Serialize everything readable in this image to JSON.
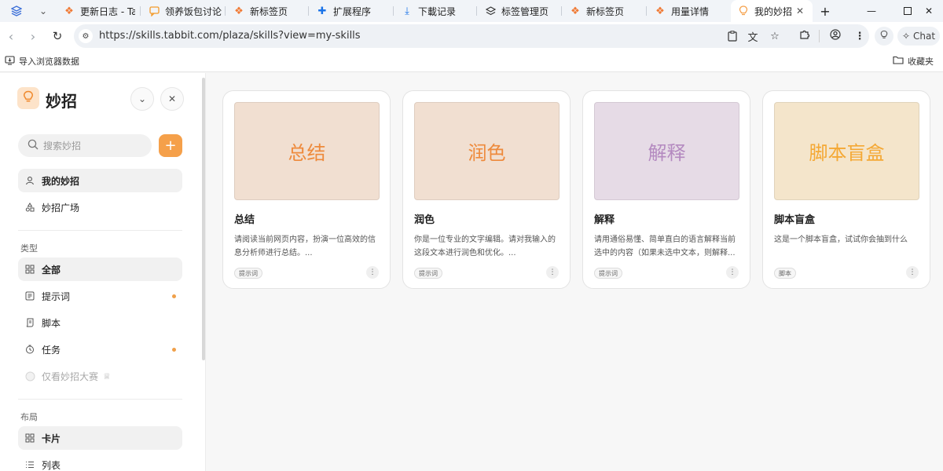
{
  "tabs": [
    {
      "title": "更新日志 - Tabl",
      "icon": "tabbit-logo-icon",
      "color": "#f07a35"
    },
    {
      "title": "领养饭包讨论",
      "icon": "chat-bubble-icon",
      "color": "#f39a2a"
    },
    {
      "title": "新标签页",
      "icon": "tabbit-logo-icon",
      "color": "#f07a35"
    },
    {
      "title": "扩展程序",
      "icon": "puzzle-icon",
      "color": "#1a73e8"
    },
    {
      "title": "下載记录",
      "icon": "download-icon",
      "color": "#1a73e8"
    },
    {
      "title": "标签管理页",
      "icon": "layers-icon",
      "color": "#333333"
    },
    {
      "title": "新标签页",
      "icon": "tabbit-logo-icon",
      "color": "#f07a35"
    },
    {
      "title": "用量详情",
      "icon": "tabbit-logo-icon",
      "color": "#f07a35"
    },
    {
      "title": "我的妙招",
      "icon": "lightbulb-icon",
      "color": "#f5a04a",
      "active": true
    }
  ],
  "address_bar": {
    "url": "https://skills.tabbit.com/plaza/skills?view=my-skills"
  },
  "chat_label": "Chat",
  "bookmarks": {
    "import_label": "导入浏览器数据",
    "favorites_label": "收藏夹"
  },
  "sidebar": {
    "title": "妙招",
    "search_placeholder": "搜索妙招",
    "nav": [
      {
        "label": "我的妙招",
        "icon": "user-icon",
        "selected": true
      },
      {
        "label": "妙招广场",
        "icon": "shapes-icon",
        "selected": false
      }
    ],
    "type_section_label": "类型",
    "types": [
      {
        "label": "全部",
        "icon": "grid-icon",
        "selected": true,
        "dot": false
      },
      {
        "label": "提示词",
        "icon": "prompt-icon",
        "selected": false,
        "dot": true
      },
      {
        "label": "脚本",
        "icon": "script-icon",
        "selected": false,
        "dot": false
      },
      {
        "label": "任务",
        "icon": "task-icon",
        "selected": false,
        "dot": true
      }
    ],
    "contest_label": "仅看妙招大赛",
    "layout_section_label": "布局",
    "layouts": [
      {
        "label": "卡片",
        "icon": "grid-icon",
        "selected": true
      },
      {
        "label": "列表",
        "icon": "list-icon",
        "selected": false
      }
    ]
  },
  "cards": [
    {
      "thumb_text": "总结",
      "thumb_bg": "#f1dfd1",
      "thumb_color": "#ee8a3c",
      "title": "总结",
      "desc": "请阅读当前网页内容，扮演一位高效的信息分析师进行总结。...",
      "badge": "提示词"
    },
    {
      "thumb_text": "润色",
      "thumb_bg": "#f1dfd1",
      "thumb_color": "#ee8a3c",
      "title": "润色",
      "desc": "你是一位专业的文字编辑。请对我输入的这段文本进行润色和优化。...",
      "badge": "提示词"
    },
    {
      "thumb_text": "解释",
      "thumb_bg": "#e6dbe6",
      "thumb_color": "#b48ac0",
      "title": "解释",
      "desc": "请用通俗易懂、简单直白的语言解释当前选中的内容（如果未选中文本，则解释...",
      "badge": "提示词"
    },
    {
      "thumb_text": "脚本盲盒",
      "thumb_bg": "#f4e5cb",
      "thumb_color": "#f4a834",
      "title": "脚本盲盒",
      "desc": "这是一个脚本盲盒，试试你会抽到什么",
      "badge": "脚本"
    }
  ]
}
